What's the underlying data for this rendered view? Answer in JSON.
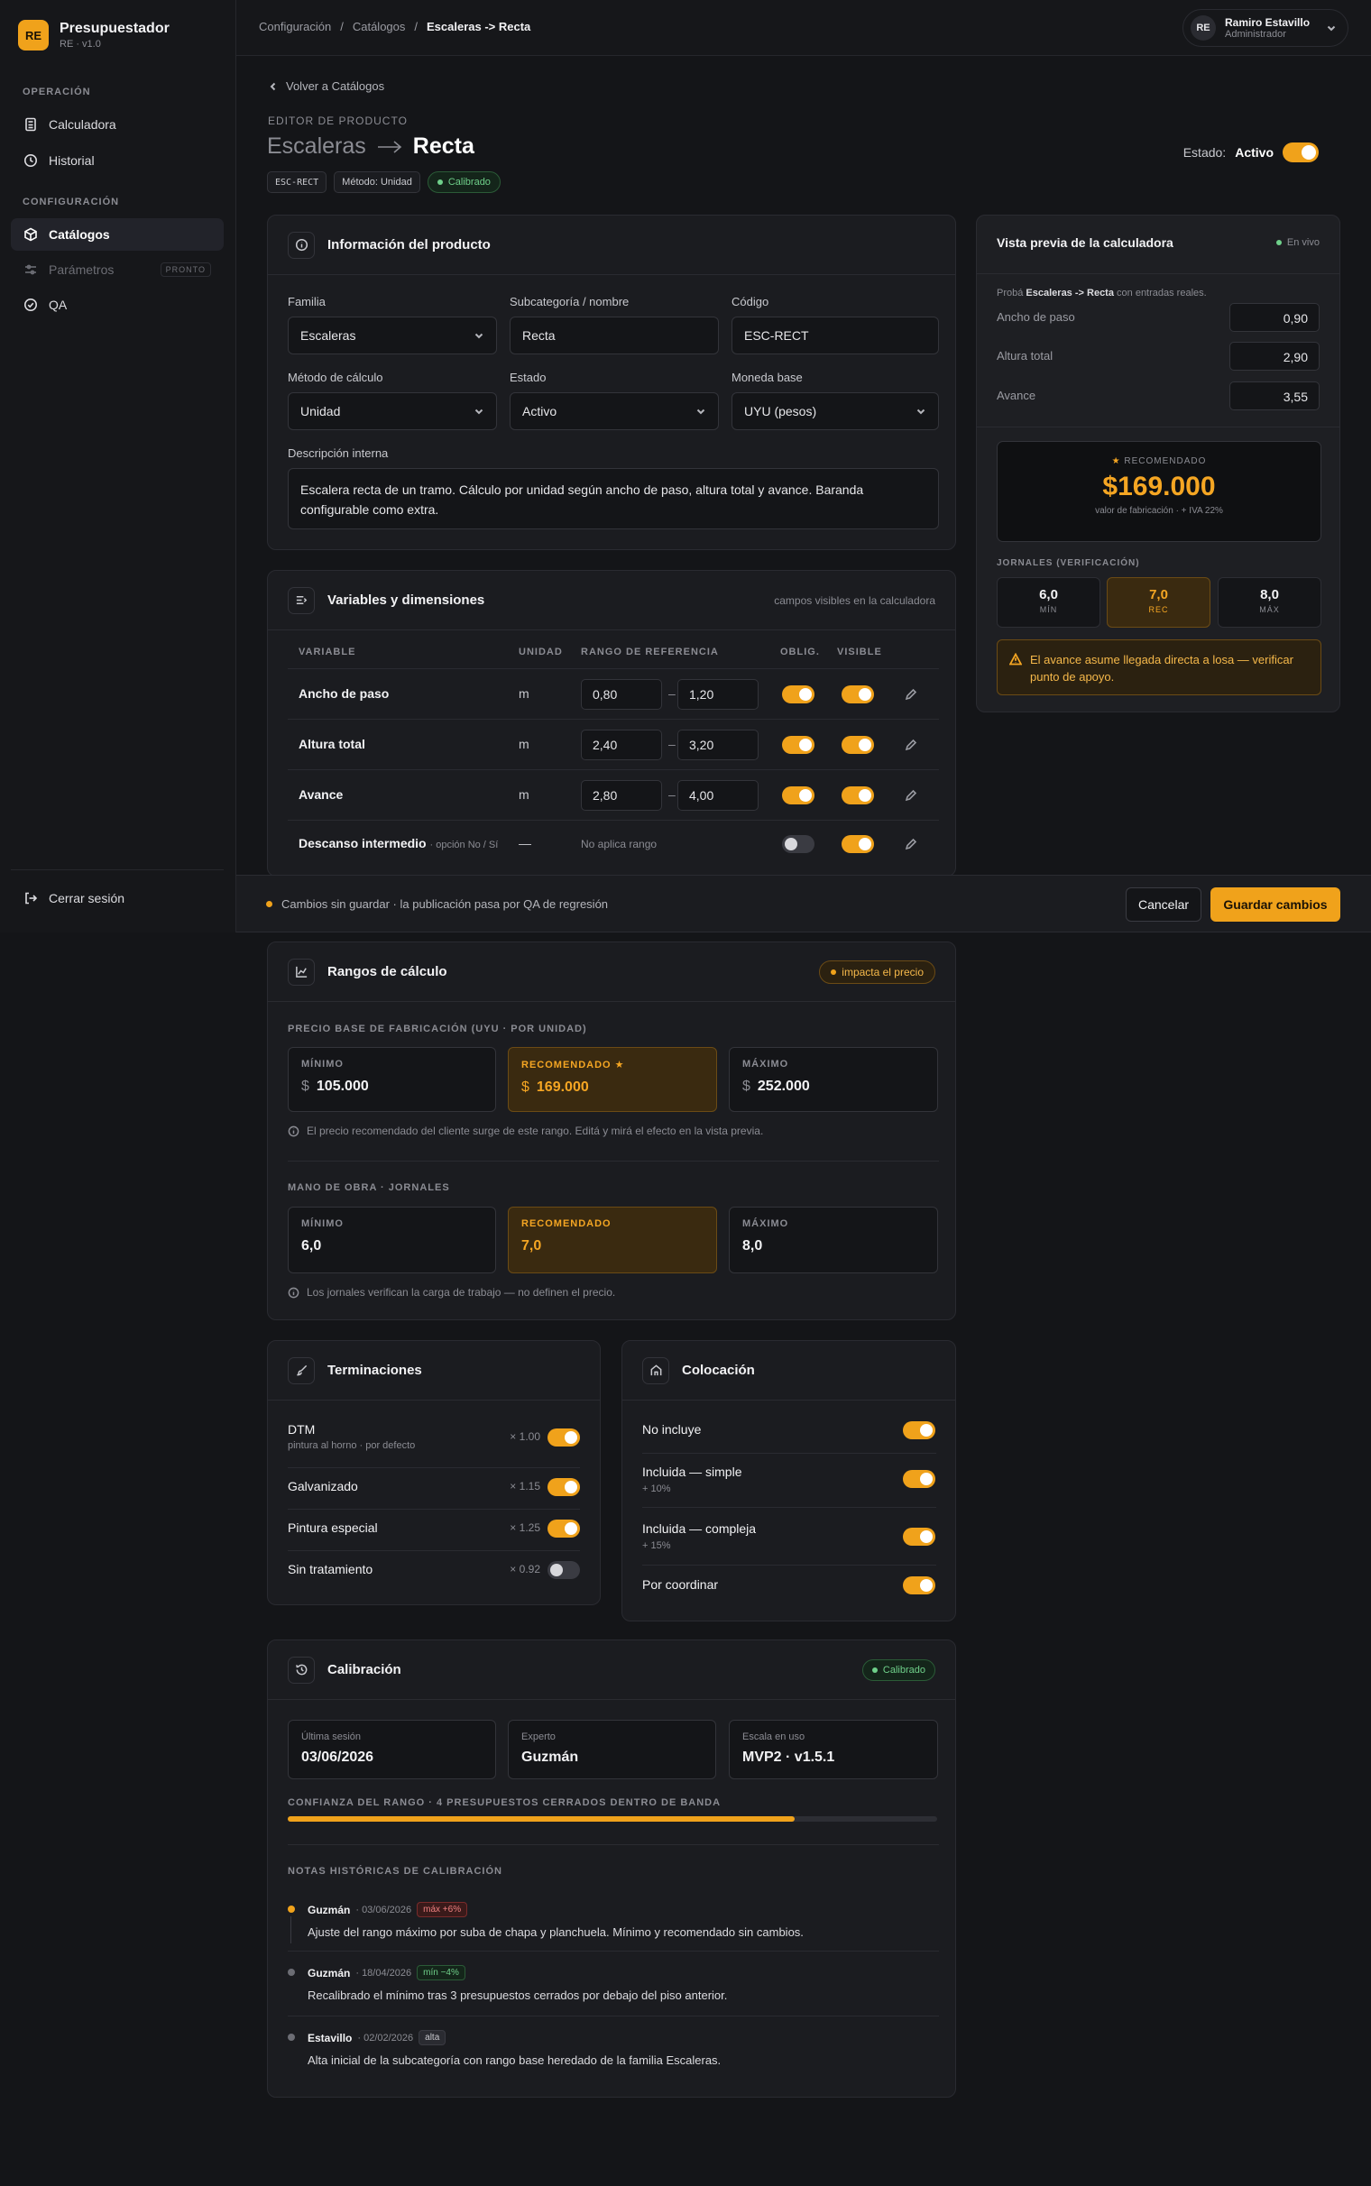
{
  "brand": {
    "logo": "RE",
    "name": "Presupuestador",
    "version": "RE · v1.0"
  },
  "sidebar": {
    "section_operacion": "OPERACIÓN",
    "section_config": "CONFIGURACIÓN",
    "items": [
      {
        "label": "Calculadora",
        "icon": "calculator-icon"
      },
      {
        "label": "Historial",
        "icon": "clock-icon"
      },
      {
        "label": "Catálogos",
        "icon": "cube-icon"
      },
      {
        "label": "Parámetros",
        "icon": "sliders-icon",
        "badge": "PRONTO"
      },
      {
        "label": "QA",
        "icon": "check-circle-icon"
      }
    ],
    "logout": "Cerrar sesión"
  },
  "breadcrumb": [
    "Configuración",
    "Catálogos",
    "Escaleras -> Recta"
  ],
  "user": {
    "initials": "RE",
    "name": "Ramiro Estavillo",
    "role": "Administrador"
  },
  "header": {
    "back": "Volver a Catálogos",
    "eyebrow": "EDITOR DE PRODUCTO",
    "title_family": "Escaleras",
    "title_name": "Recta",
    "tags": {
      "code": "ESC-RECT",
      "method": "Método: Unidad",
      "status": "Calibrado"
    },
    "estado_label": "Estado:",
    "estado_value": "Activo"
  },
  "info": {
    "title": "Información del producto",
    "familia": {
      "label": "Familia",
      "value": "Escaleras"
    },
    "subcat": {
      "label": "Subcategoría / nombre",
      "value": "Recta"
    },
    "codigo": {
      "label": "Código",
      "value": "ESC-RECT"
    },
    "metodo": {
      "label": "Método de cálculo",
      "value": "Unidad"
    },
    "estado": {
      "label": "Estado",
      "value": "Activo"
    },
    "moneda": {
      "label": "Moneda base",
      "value": "UYU (pesos)"
    },
    "desc": {
      "label": "Descripción interna",
      "value": "Escalera recta de un tramo. Cálculo por unidad según ancho de paso, altura total y avance. Baranda configurable como extra."
    }
  },
  "variables": {
    "title": "Variables y dimensiones",
    "note": "campos visibles en la calculadora",
    "headers": {
      "variable": "VARIABLE",
      "unidad": "UNIDAD",
      "rango": "RANGO DE REFERENCIA",
      "oblig": "OBLIG.",
      "visible": "VISIBLE"
    },
    "rows": [
      {
        "name": "Ancho de paso",
        "unit": "m",
        "min": "0,80",
        "max": "1,20",
        "sep": "–",
        "oblig": true,
        "visible": true
      },
      {
        "name": "Altura total",
        "unit": "m",
        "min": "2,40",
        "max": "3,20",
        "sep": "–",
        "oblig": true,
        "visible": true
      },
      {
        "name": "Avance",
        "unit": "m",
        "min": "2,80",
        "max": "4,00",
        "sep": "–",
        "oblig": true,
        "visible": true
      },
      {
        "name": "Descanso intermedio",
        "sub": "· opción No / Sí",
        "unit": "—",
        "norange": "No aplica rango",
        "oblig": false,
        "visible": true
      }
    ]
  },
  "savebar": {
    "message": "Cambios sin guardar · la publicación pasa por QA de regresión",
    "cancel": "Cancelar",
    "save": "Guardar cambios"
  },
  "preview": {
    "title": "Vista previa de la calculadora",
    "live": "En vivo",
    "intro_pre": "Probá",
    "intro_bold": "Escaleras -> Recta",
    "intro_post": "con entradas reales.",
    "inputs": [
      {
        "label": "Ancho de paso",
        "value": "0,90"
      },
      {
        "label": "Altura total",
        "value": "2,90"
      },
      {
        "label": "Avance",
        "value": "3,55"
      }
    ],
    "rec_label": "RECOMENDADO",
    "rec_value": "$169.000",
    "rec_sub": "valor de fabricación · + IVA 22%",
    "jornales_label": "JORNALES (VERIFICACIÓN)",
    "jornales": [
      {
        "value": "6,0",
        "label": "MÍN"
      },
      {
        "value": "7,0",
        "label": "REC"
      },
      {
        "value": "8,0",
        "label": "MÁX"
      }
    ],
    "warning": "El avance asume llegada directa a losa — verificar punto de apoyo."
  },
  "rangos": {
    "title": "Rangos de cálculo",
    "impact": "impacta el precio",
    "precio_label": "PRECIO BASE DE FABRICACIÓN (UYU · POR UNIDAD)",
    "precio": [
      {
        "label": "MÍNIMO",
        "cur": "$",
        "value": "105.000"
      },
      {
        "label": "RECOMENDADO ★",
        "cur": "$",
        "value": "169.000"
      },
      {
        "label": "MÁXIMO",
        "cur": "$",
        "value": "252.000"
      }
    ],
    "precio_hint": "El precio recomendado del cliente surge de este rango. Editá y mirá el efecto en la vista previa.",
    "mano_label": "MANO DE OBRA · JORNALES",
    "mano": [
      {
        "label": "MÍNIMO",
        "value": "6,0"
      },
      {
        "label": "RECOMENDADO",
        "value": "7,0"
      },
      {
        "label": "MÁXIMO",
        "value": "8,0"
      }
    ],
    "mano_hint": "Los jornales verifican la carga de trabajo — no definen el precio."
  },
  "terminaciones": {
    "title": "Terminaciones",
    "items": [
      {
        "name": "DTM",
        "sub": "pintura al horno · por defecto",
        "mult": "× 1.00",
        "on": true
      },
      {
        "name": "Galvanizado",
        "mult": "× 1.15",
        "on": true
      },
      {
        "name": "Pintura especial",
        "mult": "× 1.25",
        "on": true
      },
      {
        "name": "Sin tratamiento",
        "mult": "× 0.92",
        "on": false
      }
    ]
  },
  "colocacion": {
    "title": "Colocación",
    "items": [
      {
        "name": "No incluye",
        "on": true
      },
      {
        "name": "Incluida — simple",
        "sub": "+ 10%",
        "on": true
      },
      {
        "name": "Incluida — compleja",
        "sub": "+ 15%",
        "on": true
      },
      {
        "name": "Por coordinar",
        "on": true
      }
    ]
  },
  "calibracion": {
    "title": "Calibración",
    "badge": "Calibrado",
    "boxes": [
      {
        "label": "Última sesión",
        "value": "03/06/2026"
      },
      {
        "label": "Experto",
        "value": "Guzmán"
      },
      {
        "label": "Escala en uso",
        "value": "MVP2 · v1.5.1"
      }
    ],
    "confianza_label": "CONFIANZA DEL RANGO · 4 PRESUPUESTOS CERRADOS DENTRO DE BANDA",
    "confianza_pct": 78,
    "notas_label": "NOTAS HISTÓRICAS DE CALIBRACIÓN",
    "notas": [
      {
        "author": "Guzmán",
        "date": "· 03/06/2026",
        "chip": "máx +6%",
        "chip_kind": "red",
        "text": "Ajuste del rango máximo por suba de chapa y planchuela. Mínimo y recomendado sin cambios."
      },
      {
        "author": "Guzmán",
        "date": "· 18/04/2026",
        "chip": "mín −4%",
        "chip_kind": "green",
        "text": "Recalibrado el mínimo tras 3 presupuestos cerrados por debajo del piso anterior."
      },
      {
        "author": "Estavillo",
        "date": "· 02/02/2026",
        "chip": "alta",
        "chip_kind": "gray",
        "text": "Alta inicial de la subcategoría con rango base heredado de la familia Escaleras."
      }
    ]
  },
  "colors": {
    "accent": "#f0a21b",
    "bg": "#141518",
    "panel": "#1b1c20",
    "green": "#6fd08a"
  }
}
